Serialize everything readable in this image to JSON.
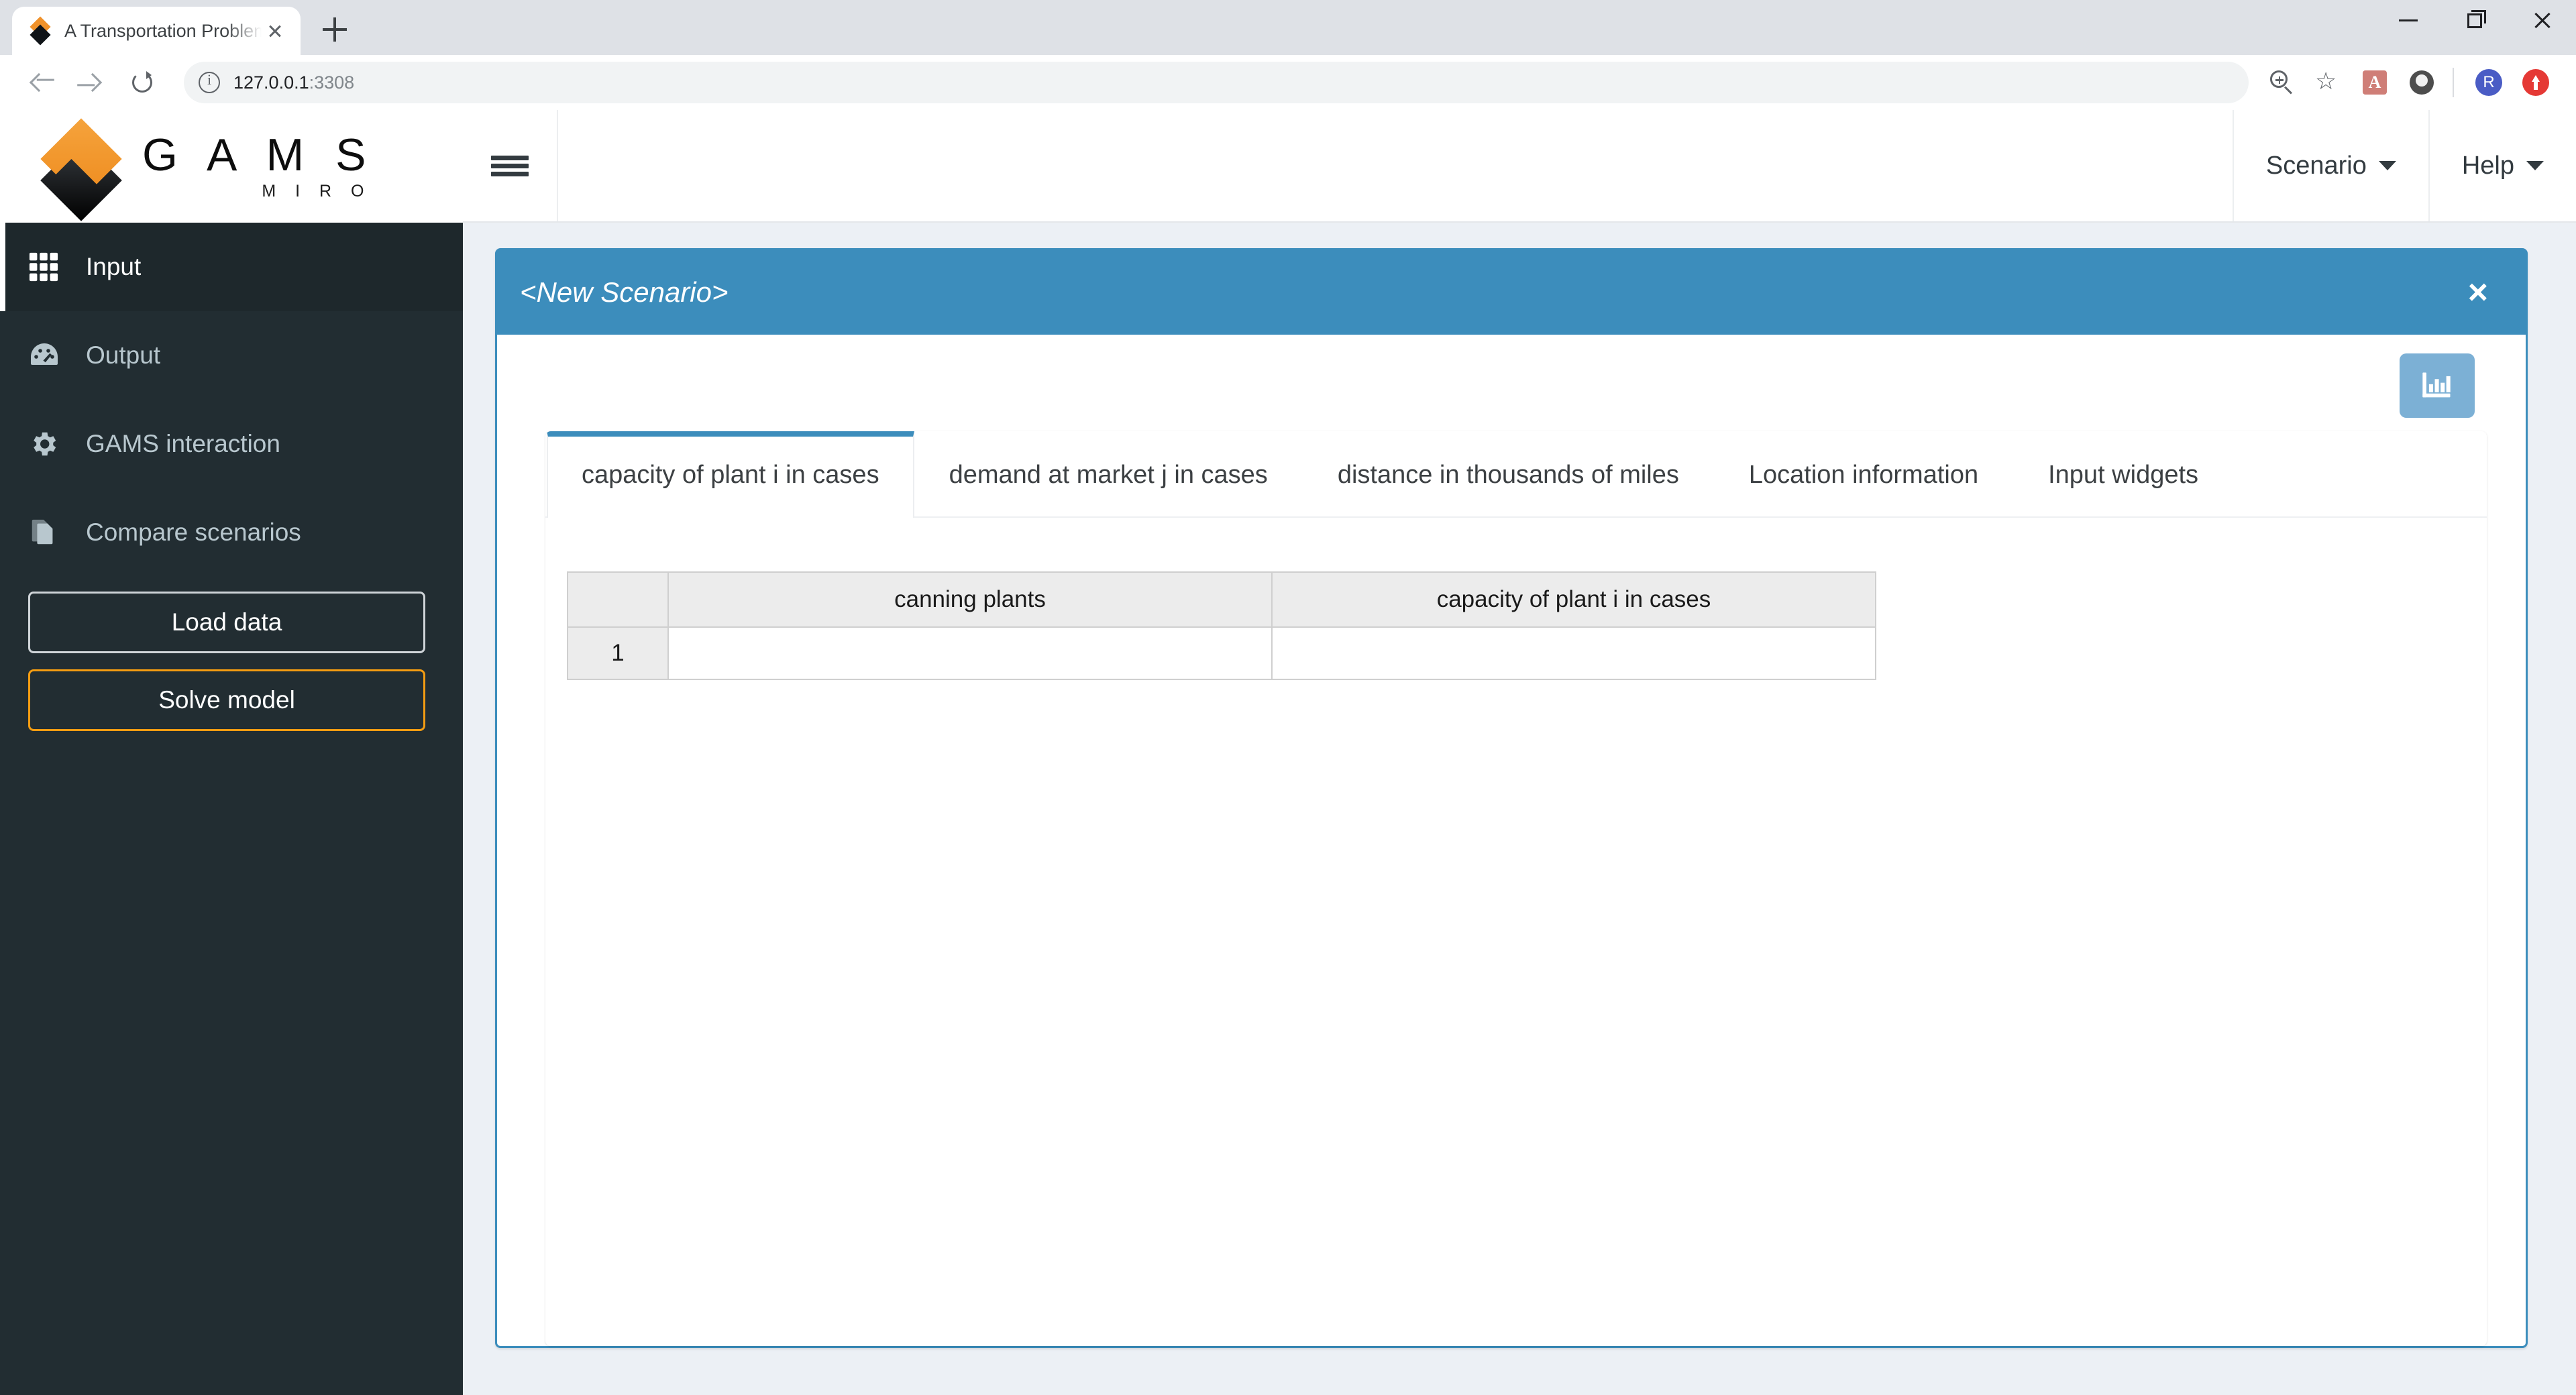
{
  "browser": {
    "tab": {
      "title": "A Transportation Problem with m",
      "favicon": "gams-miro-favicon",
      "close_label": ""
    },
    "new_tab_label": "",
    "url": "127.0.0.1",
    "url_port": ":3308",
    "window_controls": {
      "minimize": "minimize-icon",
      "maximize": "maximize-icon",
      "close": "close-icon"
    },
    "toolbar_icons": {
      "back": "back-arrow-icon",
      "forward": "forward-arrow-icon",
      "reload": "reload-icon",
      "site_info": "info-icon",
      "zoom": "zoom-in-icon",
      "bookmark": "star-icon",
      "acrobat": "A",
      "extension": "extension-icon",
      "profile": "R",
      "update": "update-icon"
    }
  },
  "sidebar": {
    "logo": {
      "gams": "G A M S",
      "miro": "M I R O"
    },
    "items": [
      {
        "label": "Input",
        "icon": "grid-icon",
        "active": true
      },
      {
        "label": "Output",
        "icon": "dashboard-icon",
        "active": false
      },
      {
        "label": "GAMS interaction",
        "icon": "gear-icon",
        "active": false
      },
      {
        "label": "Compare scenarios",
        "icon": "copy-files-icon",
        "active": false
      }
    ],
    "buttons": [
      {
        "label": "Load data",
        "style": "default"
      },
      {
        "label": "Solve model",
        "style": "accent"
      }
    ]
  },
  "topbar": {
    "menu_icon": "hamburger-icon",
    "menus": [
      {
        "label": "Scenario"
      },
      {
        "label": "Help"
      }
    ]
  },
  "panel": {
    "title": "<New Scenario>",
    "close_label": "×",
    "chart_button_icon": "bar-chart-icon",
    "tabs": [
      {
        "label": "capacity of plant i in cases",
        "active": true
      },
      {
        "label": "demand at market j in cases",
        "active": false
      },
      {
        "label": "distance in thousands of miles",
        "active": false
      },
      {
        "label": "Location information",
        "active": false
      },
      {
        "label": "Input widgets",
        "active": false
      }
    ],
    "table": {
      "headers": [
        "",
        "canning plants",
        "capacity of plant i in cases"
      ],
      "rows": [
        {
          "num": "1",
          "cells": [
            "",
            ""
          ]
        }
      ]
    }
  },
  "colors": {
    "accent_blue": "#3c8dbc",
    "sidebar_bg": "#222d32",
    "sidebar_active_bg": "#1e282c",
    "page_bg": "#ecf0f5",
    "orange": "#f39c12"
  }
}
